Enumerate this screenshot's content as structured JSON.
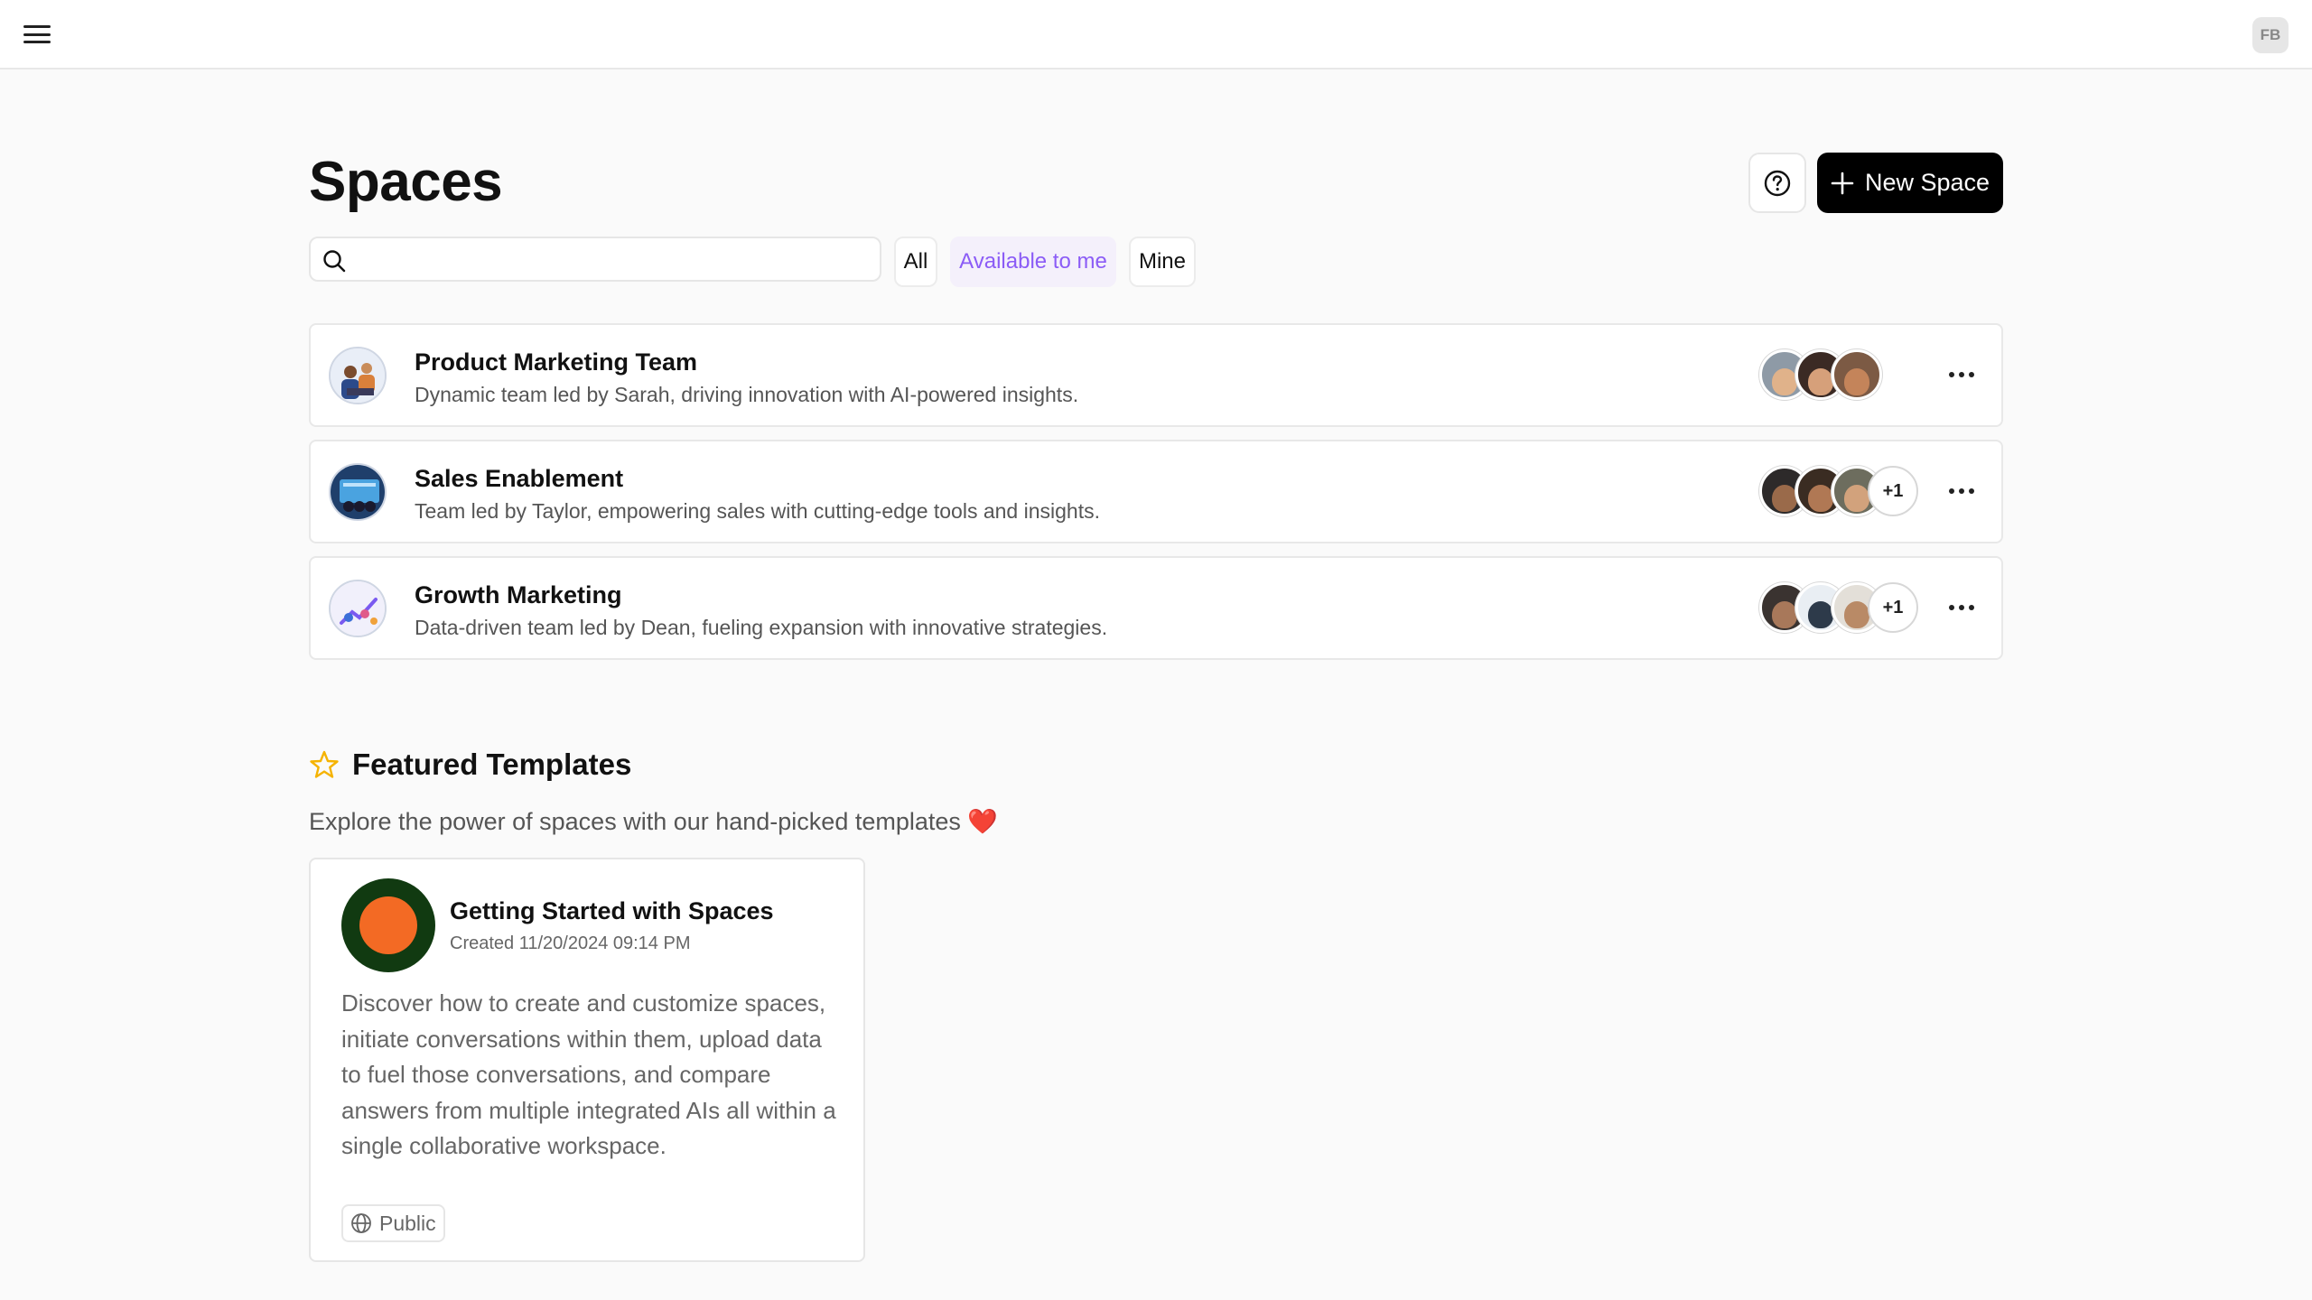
{
  "header": {
    "user_initials": "FB"
  },
  "page": {
    "title": "Spaces",
    "new_space_label": "New Space"
  },
  "search": {
    "value": "",
    "placeholder": ""
  },
  "filters": {
    "all": "All",
    "available": "Available to me",
    "mine": "Mine",
    "active": "available"
  },
  "spaces": [
    {
      "title": "Product Marketing Team",
      "description": "Dynamic team led by Sarah, driving innovation with AI-powered insights.",
      "extra_members": ""
    },
    {
      "title": "Sales Enablement",
      "description": "Team led by Taylor, empowering sales with cutting-edge tools and insights.",
      "extra_members": "+1"
    },
    {
      "title": "Growth Marketing",
      "description": "Data-driven team led by Dean, fueling expansion with innovative strategies.",
      "extra_members": "+1"
    }
  ],
  "featured": {
    "title": "Featured Templates",
    "subtitle": "Explore the power of spaces with our hand-picked templates ❤️",
    "templates": [
      {
        "name": "Getting Started with Spaces",
        "created": "Created 11/20/2024 09:14 PM",
        "description": "Discover how to create and customize spaces, initiate conversations within them, upload data to fuel those conversations, and compare answers from multiple integrated AIs all within a single collaborative workspace.",
        "visibility": "Public"
      }
    ]
  },
  "colors": {
    "accent": "#8b5cf6",
    "primary_button": "#000000",
    "star": "#f5b301",
    "template_logo_outer": "#113a11",
    "template_logo_inner": "#f36a24"
  }
}
